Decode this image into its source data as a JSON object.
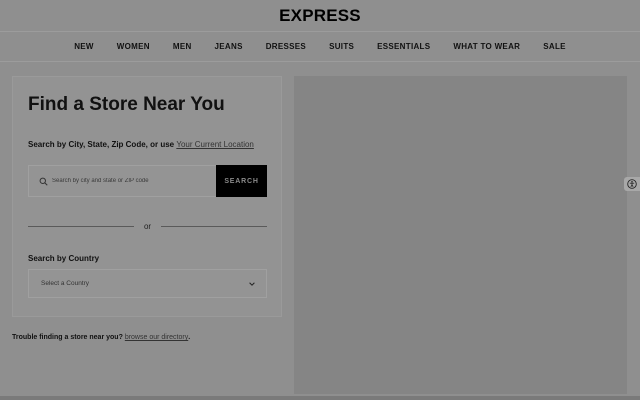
{
  "header": {
    "logo": "EXPRESS"
  },
  "nav": {
    "items": [
      "NEW",
      "WOMEN",
      "MEN",
      "JEANS",
      "DRESSES",
      "SUITS",
      "ESSENTIALS",
      "WHAT TO WEAR",
      "SALE"
    ]
  },
  "store_finder": {
    "title": "Find a Store Near You",
    "search_prompt": "Search by City, State, Zip Code, or use",
    "current_location_link": "Your Current Location",
    "search_placeholder": "Search by city and state or ZIP code",
    "search_button": "SEARCH",
    "divider_text": "or",
    "country_label": "Search by Country",
    "country_select_value": "Select a Country"
  },
  "trouble": {
    "text": "Trouble finding a store near you?",
    "link": "browse our directory",
    "suffix": "."
  },
  "icons": {
    "search": "search-icon",
    "chevron": "chevron-down-icon",
    "accessibility": "accessibility-icon"
  }
}
